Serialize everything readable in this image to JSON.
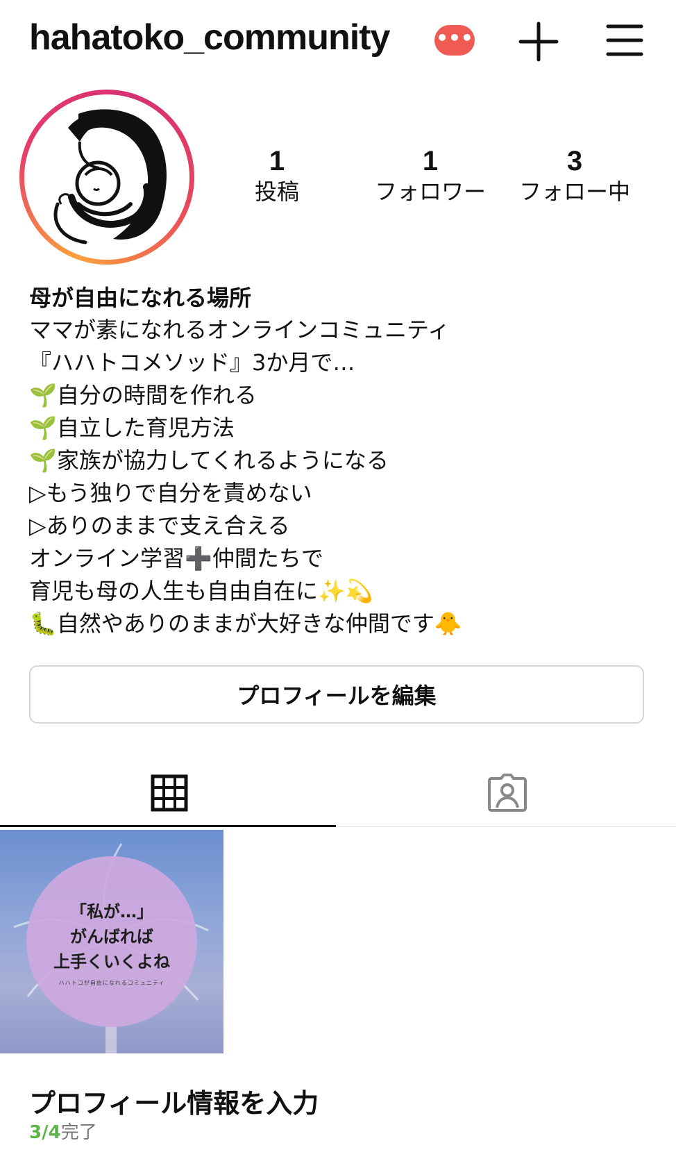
{
  "header": {
    "username": "hahatoko_community",
    "badge": "•••"
  },
  "stats": [
    {
      "value": "1",
      "label": "投稿"
    },
    {
      "value": "1",
      "label": "フォロワー"
    },
    {
      "value": "3",
      "label": "フォロー中"
    }
  ],
  "bio": {
    "name": "母が自由になれる場所",
    "lines": [
      "ママが素になれるオンラインコミュニティ",
      "『ハハトコメソッド』3か月で…",
      "🌱自分の時間を作れる",
      "🌱自立した育児方法",
      "🌱家族が協力してくれるようになる",
      "▷もう独りで自分を責めない",
      "▷ありのままで支え合える",
      "オンライン学習➕仲間たちで",
      "育児も母の人生も自由自在に✨💫",
      "🐛自然やありのままが大好きな仲間です🐥"
    ]
  },
  "edit_profile_label": "プロフィールを編集",
  "post": {
    "lines": [
      "「私が…」",
      "がんばれば",
      "上手くいくよね"
    ],
    "subtitle": "ハハトコが自由になれるコミュニティ"
  },
  "profile_info": {
    "title": "プロフィール情報を入力",
    "progress": "3/4",
    "progress_suffix": "完了"
  },
  "colors": {
    "badge": "#ef5a55",
    "progress_green": "#5db44a",
    "ring_start": "#f9a23c",
    "ring_end": "#d62f74"
  }
}
